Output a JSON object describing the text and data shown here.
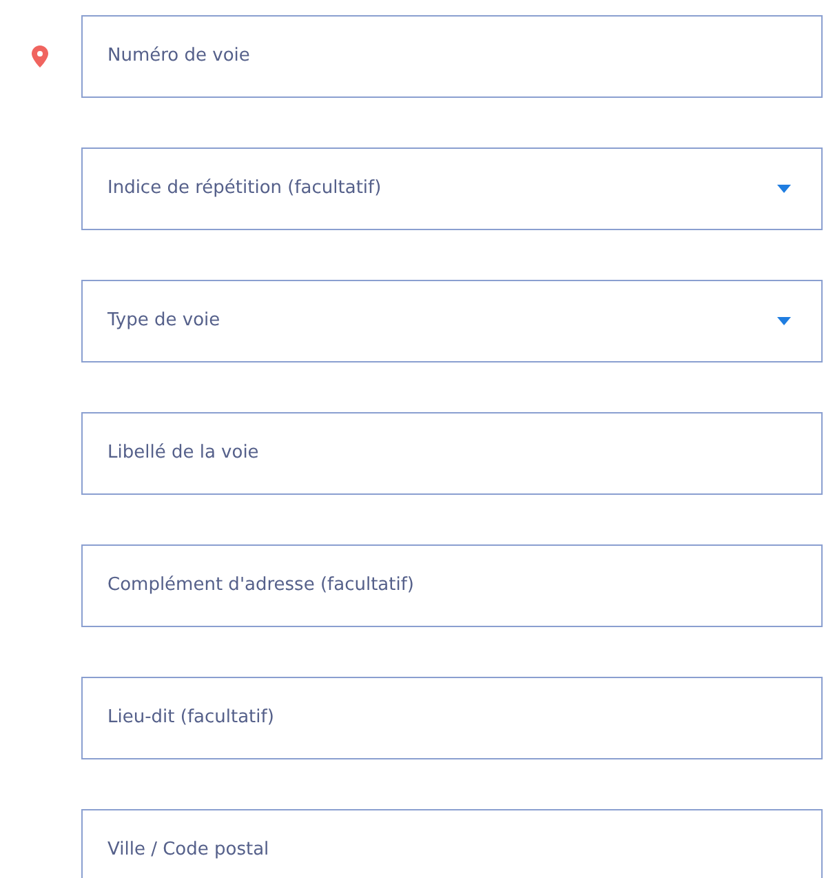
{
  "fields": [
    {
      "kind": "text",
      "placeholder": "Numéro de voie",
      "pin": true
    },
    {
      "kind": "select",
      "placeholder": "Indice de répétition (facultatif)",
      "pin": false
    },
    {
      "kind": "select",
      "placeholder": "Type de voie",
      "pin": false
    },
    {
      "kind": "text",
      "placeholder": "Libellé de la voie",
      "pin": false
    },
    {
      "kind": "text",
      "placeholder": "Complément d'adresse (facultatif)",
      "pin": false
    },
    {
      "kind": "text",
      "placeholder": "Lieu-dit (facultatif)",
      "pin": false
    },
    {
      "kind": "text",
      "placeholder": "Ville / Code postal",
      "pin": false
    }
  ]
}
